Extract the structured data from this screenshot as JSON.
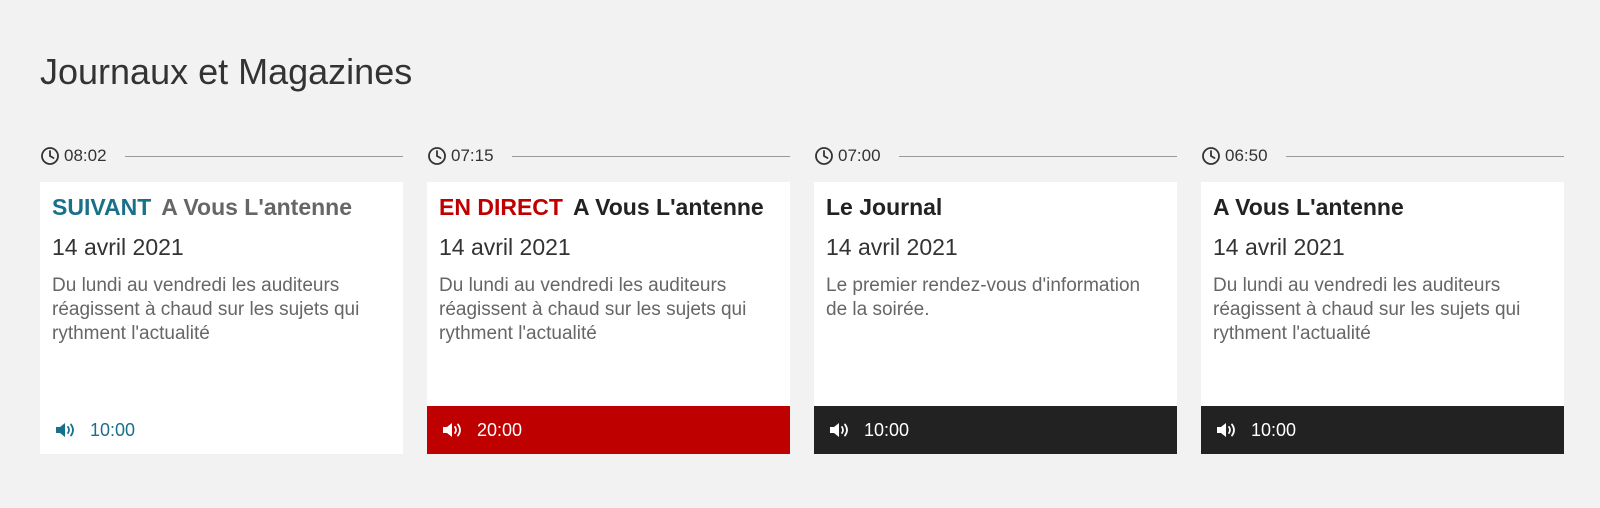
{
  "section": {
    "title": "Journaux et Magazines"
  },
  "colors": {
    "accent": "#18708a",
    "live": "#bf0000",
    "dark": "#222222"
  },
  "cards": [
    {
      "time": "08:02",
      "tag": "SUIVANT",
      "title": "A Vous L'antenne",
      "date": "14 avril 2021",
      "description": "Du lundi au vendredi les auditeurs réagissent à chaud sur les sujets qui rythment l'actualité",
      "footer_icon": "speaker-icon",
      "footer_time": "10:00"
    },
    {
      "time": "07:15",
      "tag": "EN DIRECT",
      "title": "A Vous L'antenne",
      "date": "14 avril 2021",
      "description": "Du lundi au vendredi les auditeurs réagissent à chaud sur les sujets qui rythment l'actualité",
      "footer_icon": "speaker-icon",
      "footer_time": "20:00"
    },
    {
      "time": "07:00",
      "tag": "",
      "title": "Le Journal",
      "date": "14 avril 2021",
      "description": "Le premier rendez-vous d'information de la soirée.",
      "footer_icon": "speaker-icon",
      "footer_time": "10:00"
    },
    {
      "time": "06:50",
      "tag": "",
      "title": "A Vous L'antenne",
      "date": "14 avril 2021",
      "description": "Du lundi au vendredi les auditeurs réagissent à chaud sur les sujets qui rythment l'actualité",
      "footer_icon": "speaker-icon",
      "footer_time": "10:00"
    }
  ]
}
